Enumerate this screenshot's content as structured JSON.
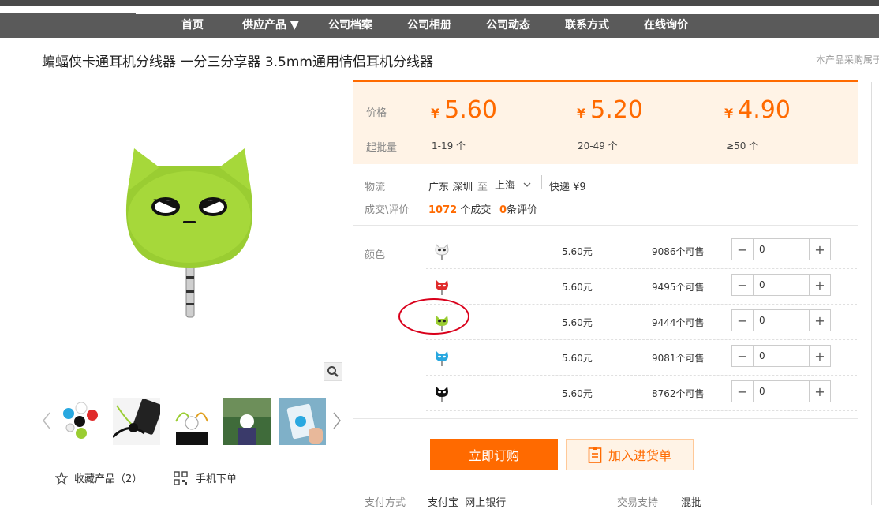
{
  "nav": {
    "items": [
      "首页",
      "供应产品 ▼",
      "公司档案",
      "公司相册",
      "公司动态",
      "联系方式",
      "在线询价"
    ]
  },
  "product": {
    "title": "蝙蝠侠卡通耳机分线器 一分三分享器 3.5mm通用情侣耳机分线器",
    "note": "本产品采购属于"
  },
  "pricing": {
    "price_label": "价格",
    "min_label": "起批量",
    "currency": "¥",
    "tiers": [
      {
        "price": "5.60",
        "qty": "1-19 个"
      },
      {
        "price": "5.20",
        "qty": "20-49 个"
      },
      {
        "price": "4.90",
        "qty": "≥50 个"
      }
    ]
  },
  "logistics": {
    "label": "物流",
    "from": "广东 深圳",
    "to_word": "至",
    "to": "上海",
    "shipping": "快递 ¥9"
  },
  "deals": {
    "label": "成交\\评价",
    "count": "1072",
    "count_suffix": "个成交",
    "reviews": "0",
    "reviews_suffix": "条评价"
  },
  "variants": {
    "label": "颜色",
    "rows": [
      {
        "color": "white",
        "price": "5.60元",
        "stock": "9086个可售",
        "qty": "0"
      },
      {
        "color": "red",
        "price": "5.60元",
        "stock": "9495个可售",
        "qty": "0"
      },
      {
        "color": "green",
        "price": "5.60元",
        "stock": "9444个可售",
        "qty": "0"
      },
      {
        "color": "blue",
        "price": "5.60元",
        "stock": "9081个可售",
        "qty": "0"
      },
      {
        "color": "black",
        "price": "5.60元",
        "stock": "8762个可售",
        "qty": "0"
      }
    ]
  },
  "actions": {
    "order": "立即订购",
    "cart": "加入进货单",
    "favorite": "收藏产品（2）",
    "mobile": "手机下单"
  },
  "footer": {
    "pay_label": "支付方式",
    "pay_value": "支付宝  网上银行",
    "trade_label": "交易支持",
    "trade_value": "混批"
  },
  "colors": {
    "accent": "#ff6a00",
    "nav_bg": "#5a5a5a",
    "price_bg": "#fff3e6",
    "highlight": "#d9001b"
  }
}
